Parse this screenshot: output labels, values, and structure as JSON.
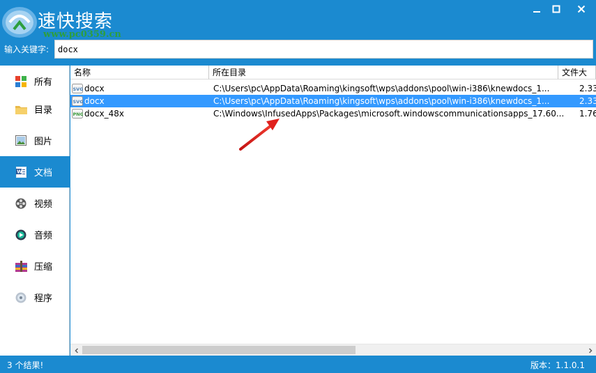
{
  "window": {
    "title": "速快搜索",
    "watermark_site": "www.pc0359.cn",
    "minimize_icon": "minimize-icon",
    "maximize_icon": "maximize-icon",
    "close_icon": "close-icon"
  },
  "search": {
    "label": "输入关键字:",
    "value": "docx"
  },
  "sidebar": {
    "items": [
      {
        "label": "所有",
        "icon": "grid-icon"
      },
      {
        "label": "目录",
        "icon": "folder-icon"
      },
      {
        "label": "图片",
        "icon": "image-icon"
      },
      {
        "label": "文档",
        "icon": "document-icon",
        "active": true
      },
      {
        "label": "视频",
        "icon": "film-reel-icon"
      },
      {
        "label": "音频",
        "icon": "audio-icon"
      },
      {
        "label": "压缩",
        "icon": "archive-icon"
      },
      {
        "label": "程序",
        "icon": "program-disc-icon"
      }
    ]
  },
  "table": {
    "columns": [
      "名称",
      "所在目录",
      "文件大"
    ],
    "rows": [
      {
        "name": "docx",
        "path": "C:\\Users\\pc\\AppData\\Roaming\\kingsoft\\wps\\addons\\pool\\win-i386\\knewdocs_1...",
        "size": "2.33",
        "selected": false,
        "icon": "svg-file-icon"
      },
      {
        "name": "docx",
        "path": "C:\\Users\\pc\\AppData\\Roaming\\kingsoft\\wps\\addons\\pool\\win-i386\\knewdocs_1...",
        "size": "2.33",
        "selected": true,
        "icon": "svg-file-icon"
      },
      {
        "name": "docx_48x",
        "path": "C:\\Windows\\InfusedApps\\Packages\\microsoft.windowscommunicationsapps_17.60...",
        "size": "1.76",
        "selected": false,
        "icon": "png-file-icon"
      }
    ]
  },
  "status": {
    "result_count": "3 个结果!",
    "version": "版本：1.1.0.1"
  },
  "colors": {
    "accent": "#1b8ad0",
    "selection": "#3399ff",
    "annotation_arrow": "#e0201c"
  }
}
